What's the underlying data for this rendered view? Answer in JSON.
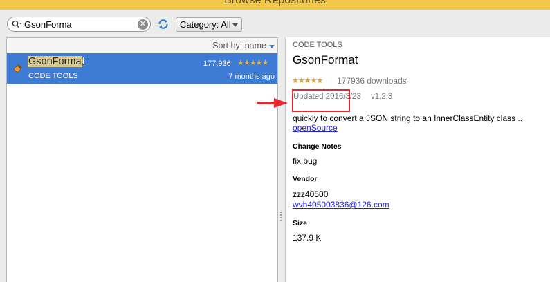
{
  "window": {
    "title": "Browse Repositories"
  },
  "toolbar": {
    "search_value": "GsonForma",
    "category_label": "Category: All"
  },
  "list": {
    "sort_label": "Sort by: name",
    "items": [
      {
        "name_highlight": "GsonForma",
        "name_rest": "t",
        "category": "CODE TOOLS",
        "downloads": "177,936",
        "rating": "★★★★★",
        "age": "7 months ago"
      }
    ]
  },
  "details": {
    "category": "CODE TOOLS",
    "name": "GsonFormat",
    "rating": "★★★★★",
    "downloads": "177936 downloads",
    "updated": "Updated 2016/3/23",
    "version": "v1.2.3",
    "description": "quickly to convert a JSON string to an InnerClassEntity class ..",
    "source_link": "openSource",
    "change_notes_heading": "Change Notes",
    "change_notes": "fix bug",
    "vendor_heading": "Vendor",
    "vendor_name": "zzz40500",
    "vendor_email": "wvh405003836@126.com",
    "size_heading": "Size",
    "size": "137.9 K"
  },
  "colors": {
    "selection": "#3d7bd4",
    "annotation": "#e8262b",
    "link": "#1e1ee6",
    "star": "#e0a33a"
  }
}
